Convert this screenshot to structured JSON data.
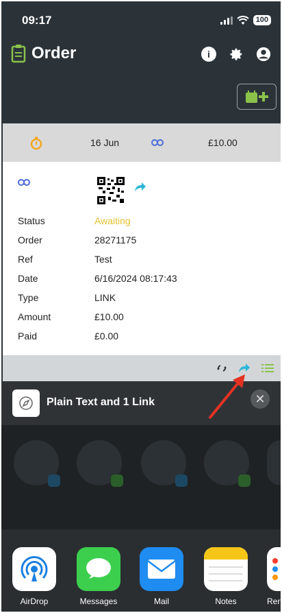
{
  "status_bar": {
    "time": "09:17",
    "battery": "100"
  },
  "header": {
    "title": "Order",
    "icons": [
      "info-icon",
      "gear-icon",
      "account-icon"
    ]
  },
  "colors": {
    "accent_green": "#8bc34a",
    "timer_orange": "#f5a623",
    "status_yellow": "#e2c22e",
    "share_blue": "#2fb6d9",
    "link_blue": "#4a6ed9"
  },
  "order_card": {
    "summary": {
      "date": "16 Jun",
      "amount": "£10.00"
    },
    "rows": [
      {
        "label": "Status",
        "value": "Awaiting"
      },
      {
        "label": "Order",
        "value": "28271175"
      },
      {
        "label": "Ref",
        "value": "Test"
      },
      {
        "label": "Date",
        "value": "6/16/2024 08:17:43"
      },
      {
        "label": "Type",
        "value": "LINK"
      },
      {
        "label": "Amount",
        "value": "£10.00"
      },
      {
        "label": "Paid",
        "value": "£0.00"
      }
    ]
  },
  "share_sheet": {
    "title": "Plain Text and 1 Link",
    "apps": [
      {
        "label": "AirDrop"
      },
      {
        "label": "Messages"
      },
      {
        "label": "Mail"
      },
      {
        "label": "Notes"
      },
      {
        "label": "Ren"
      }
    ]
  }
}
